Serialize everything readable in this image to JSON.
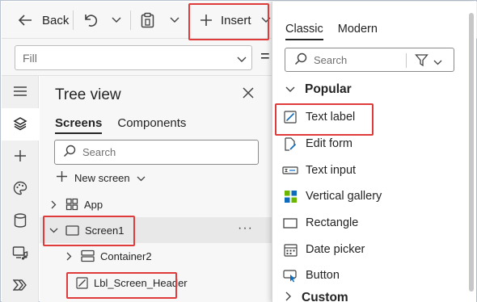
{
  "toolbar": {
    "back_label": "Back",
    "insert_label": "Insert"
  },
  "property_bar": {
    "property_value": "Fill",
    "equals_sign": "="
  },
  "tree_view": {
    "title": "Tree view",
    "tabs": [
      {
        "label": "Screens",
        "active": true
      },
      {
        "label": "Components",
        "active": false
      }
    ],
    "search_placeholder": "Search",
    "new_screen_label": "New screen",
    "nodes": [
      {
        "label": "App",
        "icon": "app-icon",
        "expanded": false
      },
      {
        "label": "Screen1",
        "icon": "screen-icon",
        "expanded": true,
        "selected": true
      },
      {
        "label": "Container2",
        "icon": "container-icon",
        "expanded": false
      },
      {
        "label": "Lbl_Screen_Header",
        "icon": "text-label-icon"
      }
    ],
    "more_options": "···"
  },
  "insert_panel": {
    "tabs": [
      {
        "label": "Classic",
        "active": true
      },
      {
        "label": "Modern",
        "active": false
      }
    ],
    "search_placeholder": "Search",
    "sections": [
      {
        "label": "Popular",
        "expanded": true
      },
      {
        "label": "Custom",
        "expanded": false
      }
    ],
    "items": [
      {
        "label": "Text label",
        "icon": "text-label-icon"
      },
      {
        "label": "Edit form",
        "icon": "edit-form-icon"
      },
      {
        "label": "Text input",
        "icon": "text-input-icon"
      },
      {
        "label": "Vertical gallery",
        "icon": "gallery-icon"
      },
      {
        "label": "Rectangle",
        "icon": "rectangle-icon"
      },
      {
        "label": "Date picker",
        "icon": "calendar-icon"
      },
      {
        "label": "Button",
        "icon": "button-icon"
      }
    ]
  },
  "colors": {
    "highlight_box": "#e03b3b",
    "gallery_green": "#6bb700",
    "gallery_blue": "#0f6cbd",
    "accent_blue": "#0f6cbd"
  }
}
